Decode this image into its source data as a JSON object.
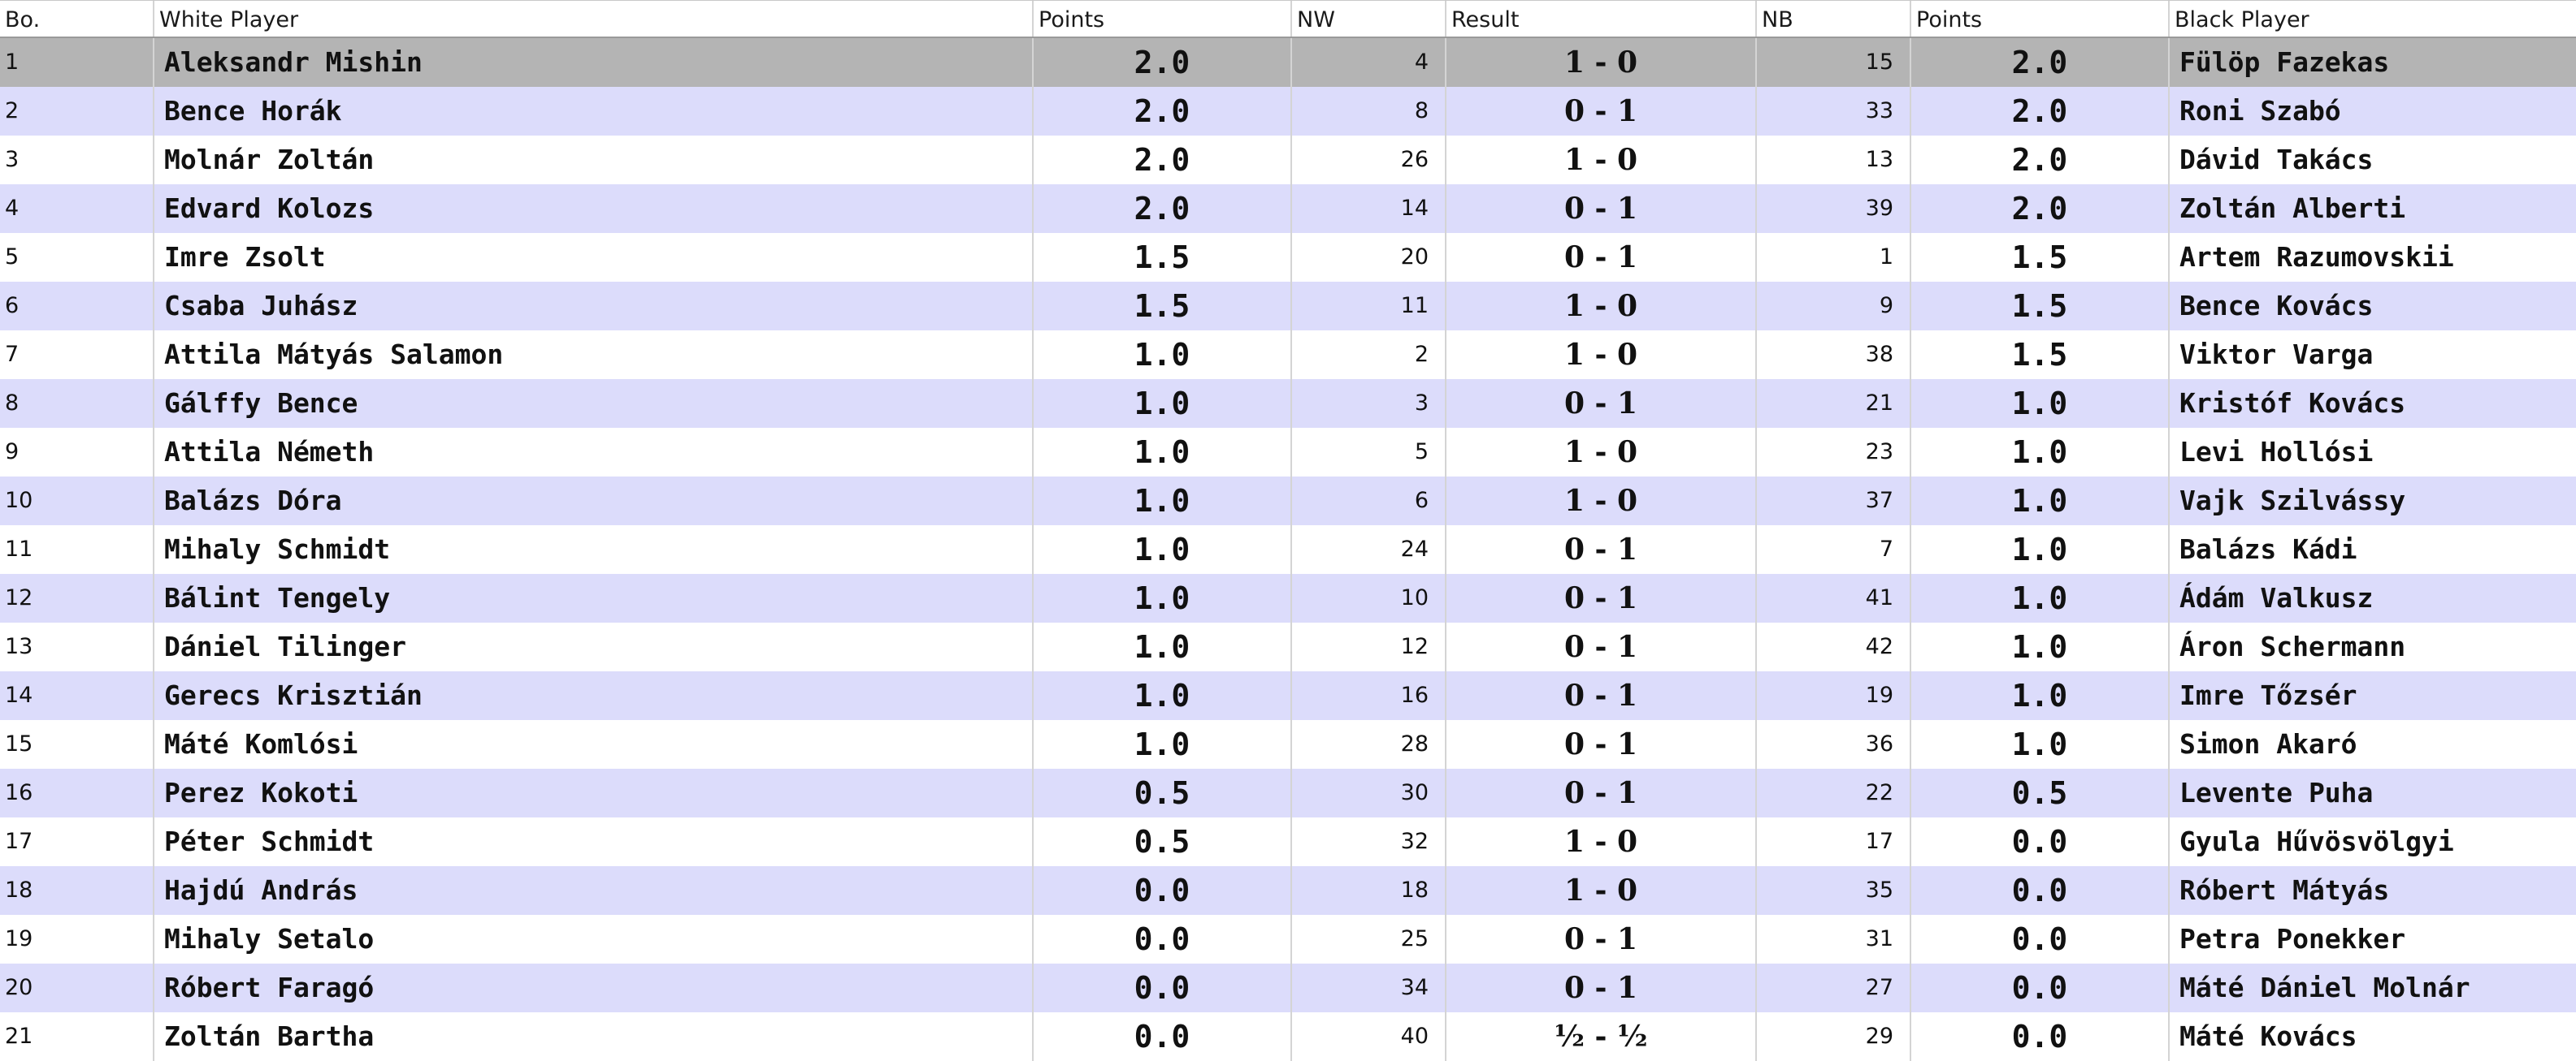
{
  "columns": {
    "board": "Bo.",
    "white_player": "White Player",
    "white_points": "Points",
    "nw": "NW",
    "result": "Result",
    "nb": "NB",
    "black_points": "Points",
    "black_player": "Black Player"
  },
  "colors": {
    "row_alt": "#dcdcfb",
    "row_selected": "#b4b4b4",
    "row_plain": "#ffffff"
  },
  "selected_row": 1,
  "rows": [
    {
      "bo": "1",
      "white": "Aleksandr Mishin",
      "wpts": "2.0",
      "nw": "4",
      "result": "1 - 0",
      "nb": "15",
      "bpts": "2.0",
      "black": "Fülöp Fazekas"
    },
    {
      "bo": "2",
      "white": "Bence Horák",
      "wpts": "2.0",
      "nw": "8",
      "result": "0 - 1",
      "nb": "33",
      "bpts": "2.0",
      "black": "Roni Szabó"
    },
    {
      "bo": "3",
      "white": "Molnár Zoltán",
      "wpts": "2.0",
      "nw": "26",
      "result": "1 - 0",
      "nb": "13",
      "bpts": "2.0",
      "black": "Dávid Takács"
    },
    {
      "bo": "4",
      "white": "Edvard Kolozs",
      "wpts": "2.0",
      "nw": "14",
      "result": "0 - 1",
      "nb": "39",
      "bpts": "2.0",
      "black": "Zoltán Alberti"
    },
    {
      "bo": "5",
      "white": "Imre Zsolt",
      "wpts": "1.5",
      "nw": "20",
      "result": "0 - 1",
      "nb": "1",
      "bpts": "1.5",
      "black": "Artem Razumovskii"
    },
    {
      "bo": "6",
      "white": "Csaba Juhász",
      "wpts": "1.5",
      "nw": "11",
      "result": "1 - 0",
      "nb": "9",
      "bpts": "1.5",
      "black": "Bence Kovács"
    },
    {
      "bo": "7",
      "white": "Attila Mátyás Salamon",
      "wpts": "1.0",
      "nw": "2",
      "result": "1 - 0",
      "nb": "38",
      "bpts": "1.5",
      "black": "Viktor Varga"
    },
    {
      "bo": "8",
      "white": "Gálffy Bence",
      "wpts": "1.0",
      "nw": "3",
      "result": "0 - 1",
      "nb": "21",
      "bpts": "1.0",
      "black": "Kristóf Kovács"
    },
    {
      "bo": "9",
      "white": "Attila Németh",
      "wpts": "1.0",
      "nw": "5",
      "result": "1 - 0",
      "nb": "23",
      "bpts": "1.0",
      "black": "Levi Hollósi"
    },
    {
      "bo": "10",
      "white": "Balázs Dóra",
      "wpts": "1.0",
      "nw": "6",
      "result": "1 - 0",
      "nb": "37",
      "bpts": "1.0",
      "black": "Vajk Szilvássy"
    },
    {
      "bo": "11",
      "white": "Mihaly Schmidt",
      "wpts": "1.0",
      "nw": "24",
      "result": "0 - 1",
      "nb": "7",
      "bpts": "1.0",
      "black": "Balázs Kádi"
    },
    {
      "bo": "12",
      "white": "Bálint Tengely",
      "wpts": "1.0",
      "nw": "10",
      "result": "0 - 1",
      "nb": "41",
      "bpts": "1.0",
      "black": "Ádám Valkusz"
    },
    {
      "bo": "13",
      "white": "Dániel Tilinger",
      "wpts": "1.0",
      "nw": "12",
      "result": "0 - 1",
      "nb": "42",
      "bpts": "1.0",
      "black": "Áron Schermann"
    },
    {
      "bo": "14",
      "white": "Gerecs Krisztián",
      "wpts": "1.0",
      "nw": "16",
      "result": "0 - 1",
      "nb": "19",
      "bpts": "1.0",
      "black": "Imre Tőzsér"
    },
    {
      "bo": "15",
      "white": "Máté Komlósi",
      "wpts": "1.0",
      "nw": "28",
      "result": "0 - 1",
      "nb": "36",
      "bpts": "1.0",
      "black": "Simon Akaró"
    },
    {
      "bo": "16",
      "white": "Perez Kokoti",
      "wpts": "0.5",
      "nw": "30",
      "result": "0 - 1",
      "nb": "22",
      "bpts": "0.5",
      "black": "Levente Puha"
    },
    {
      "bo": "17",
      "white": "Péter Schmidt",
      "wpts": "0.5",
      "nw": "32",
      "result": "1 - 0",
      "nb": "17",
      "bpts": "0.0",
      "black": "Gyula Hűvösvölgyi"
    },
    {
      "bo": "18",
      "white": "Hajdú András",
      "wpts": "0.0",
      "nw": "18",
      "result": "1 - 0",
      "nb": "35",
      "bpts": "0.0",
      "black": "Róbert Mátyás"
    },
    {
      "bo": "19",
      "white": "Mihaly Setalo",
      "wpts": "0.0",
      "nw": "25",
      "result": "0 - 1",
      "nb": "31",
      "bpts": "0.0",
      "black": "Petra Ponekker"
    },
    {
      "bo": "20",
      "white": "Róbert Faragó",
      "wpts": "0.0",
      "nw": "34",
      "result": "0 - 1",
      "nb": "27",
      "bpts": "0.0",
      "black": "Máté Dániel Molnár"
    },
    {
      "bo": "21",
      "white": "Zoltán Bartha",
      "wpts": "0.0",
      "nw": "40",
      "result": "½ - ½",
      "nb": "29",
      "bpts": "0.0",
      "black": "Máté Kovács"
    }
  ]
}
